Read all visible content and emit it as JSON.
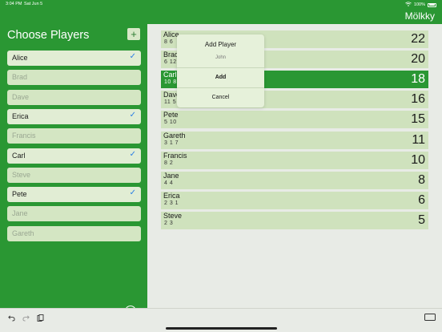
{
  "status_bar": {
    "time": "3:04 PM",
    "date": "Sat Jun 5",
    "battery": "100%"
  },
  "app": {
    "title": "Mölkky"
  },
  "sidebar": {
    "title": "Choose Players",
    "add_label": "+",
    "players": [
      {
        "name": "Alice",
        "selected": true
      },
      {
        "name": "Brad",
        "selected": false
      },
      {
        "name": "Dave",
        "selected": false
      },
      {
        "name": "Erica",
        "selected": true
      },
      {
        "name": "Francis",
        "selected": false
      },
      {
        "name": "Carl",
        "selected": true
      },
      {
        "name": "Steve",
        "selected": false
      },
      {
        "name": "Pete",
        "selected": true
      },
      {
        "name": "Jane",
        "selected": false
      },
      {
        "name": "Gareth",
        "selected": false
      }
    ]
  },
  "scores": [
    {
      "name": "Alice",
      "throws": "8 6",
      "total": "22"
    },
    {
      "name": "Brad",
      "throws": "6 12",
      "total": "20"
    },
    {
      "name": "Carl",
      "throws": "10 8",
      "total": "18",
      "highlight": true
    },
    {
      "name": "Dave",
      "throws": "11 5",
      "total": "16"
    },
    {
      "name": "Pete",
      "throws": "5 10",
      "total": "15"
    },
    {
      "name": "Gareth",
      "throws": "3 1 7",
      "total": "11"
    },
    {
      "name": "Francis",
      "throws": "8 2",
      "total": "10"
    },
    {
      "name": "Jane",
      "throws": "4 4",
      "total": "8"
    },
    {
      "name": "Erica",
      "throws": "2 3 1",
      "total": "6"
    },
    {
      "name": "Steve",
      "throws": "2 3",
      "total": "5"
    }
  ],
  "dialog": {
    "title": "Add Player",
    "input_value": "John",
    "add_label": "Add",
    "cancel_label": "Cancel"
  },
  "toolbar": {
    "undo_icon": "undo-icon",
    "redo_icon": "redo-icon",
    "paste_icon": "clipboard-icon",
    "keyboard_icon": "keyboard-icon"
  }
}
